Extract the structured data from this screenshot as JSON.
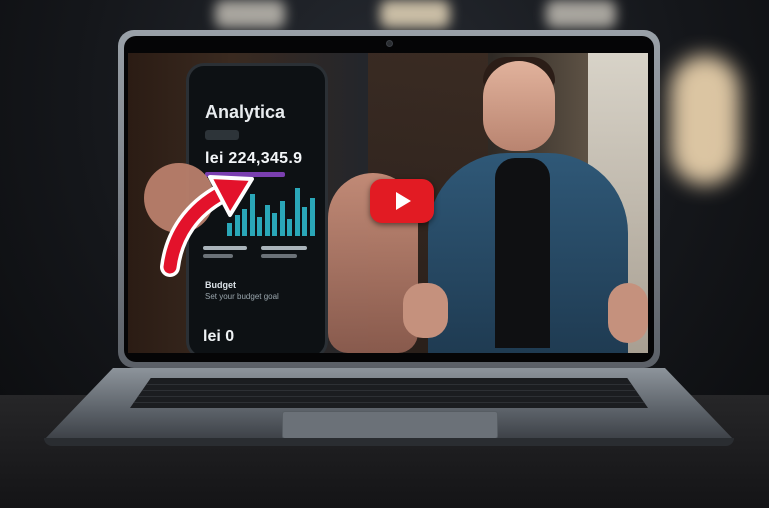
{
  "video": {
    "phone_app": {
      "title": "Analytica",
      "amount": "lei 224,345.9",
      "budget_label": "Budget",
      "budget_sub": "Set your budget goal",
      "bottom_amount": "lei 0"
    },
    "play_button": {
      "icon": "play-icon",
      "color": "#e21b23"
    },
    "annotation": {
      "icon": "curved-arrow-icon",
      "color": "#e3122b"
    }
  },
  "chart_bars": [
    12,
    20,
    26,
    40,
    18,
    30,
    22,
    34,
    16,
    46,
    28,
    36
  ],
  "colors": {
    "bar": "#2aa7b8",
    "accent": "#7a3fb0"
  }
}
